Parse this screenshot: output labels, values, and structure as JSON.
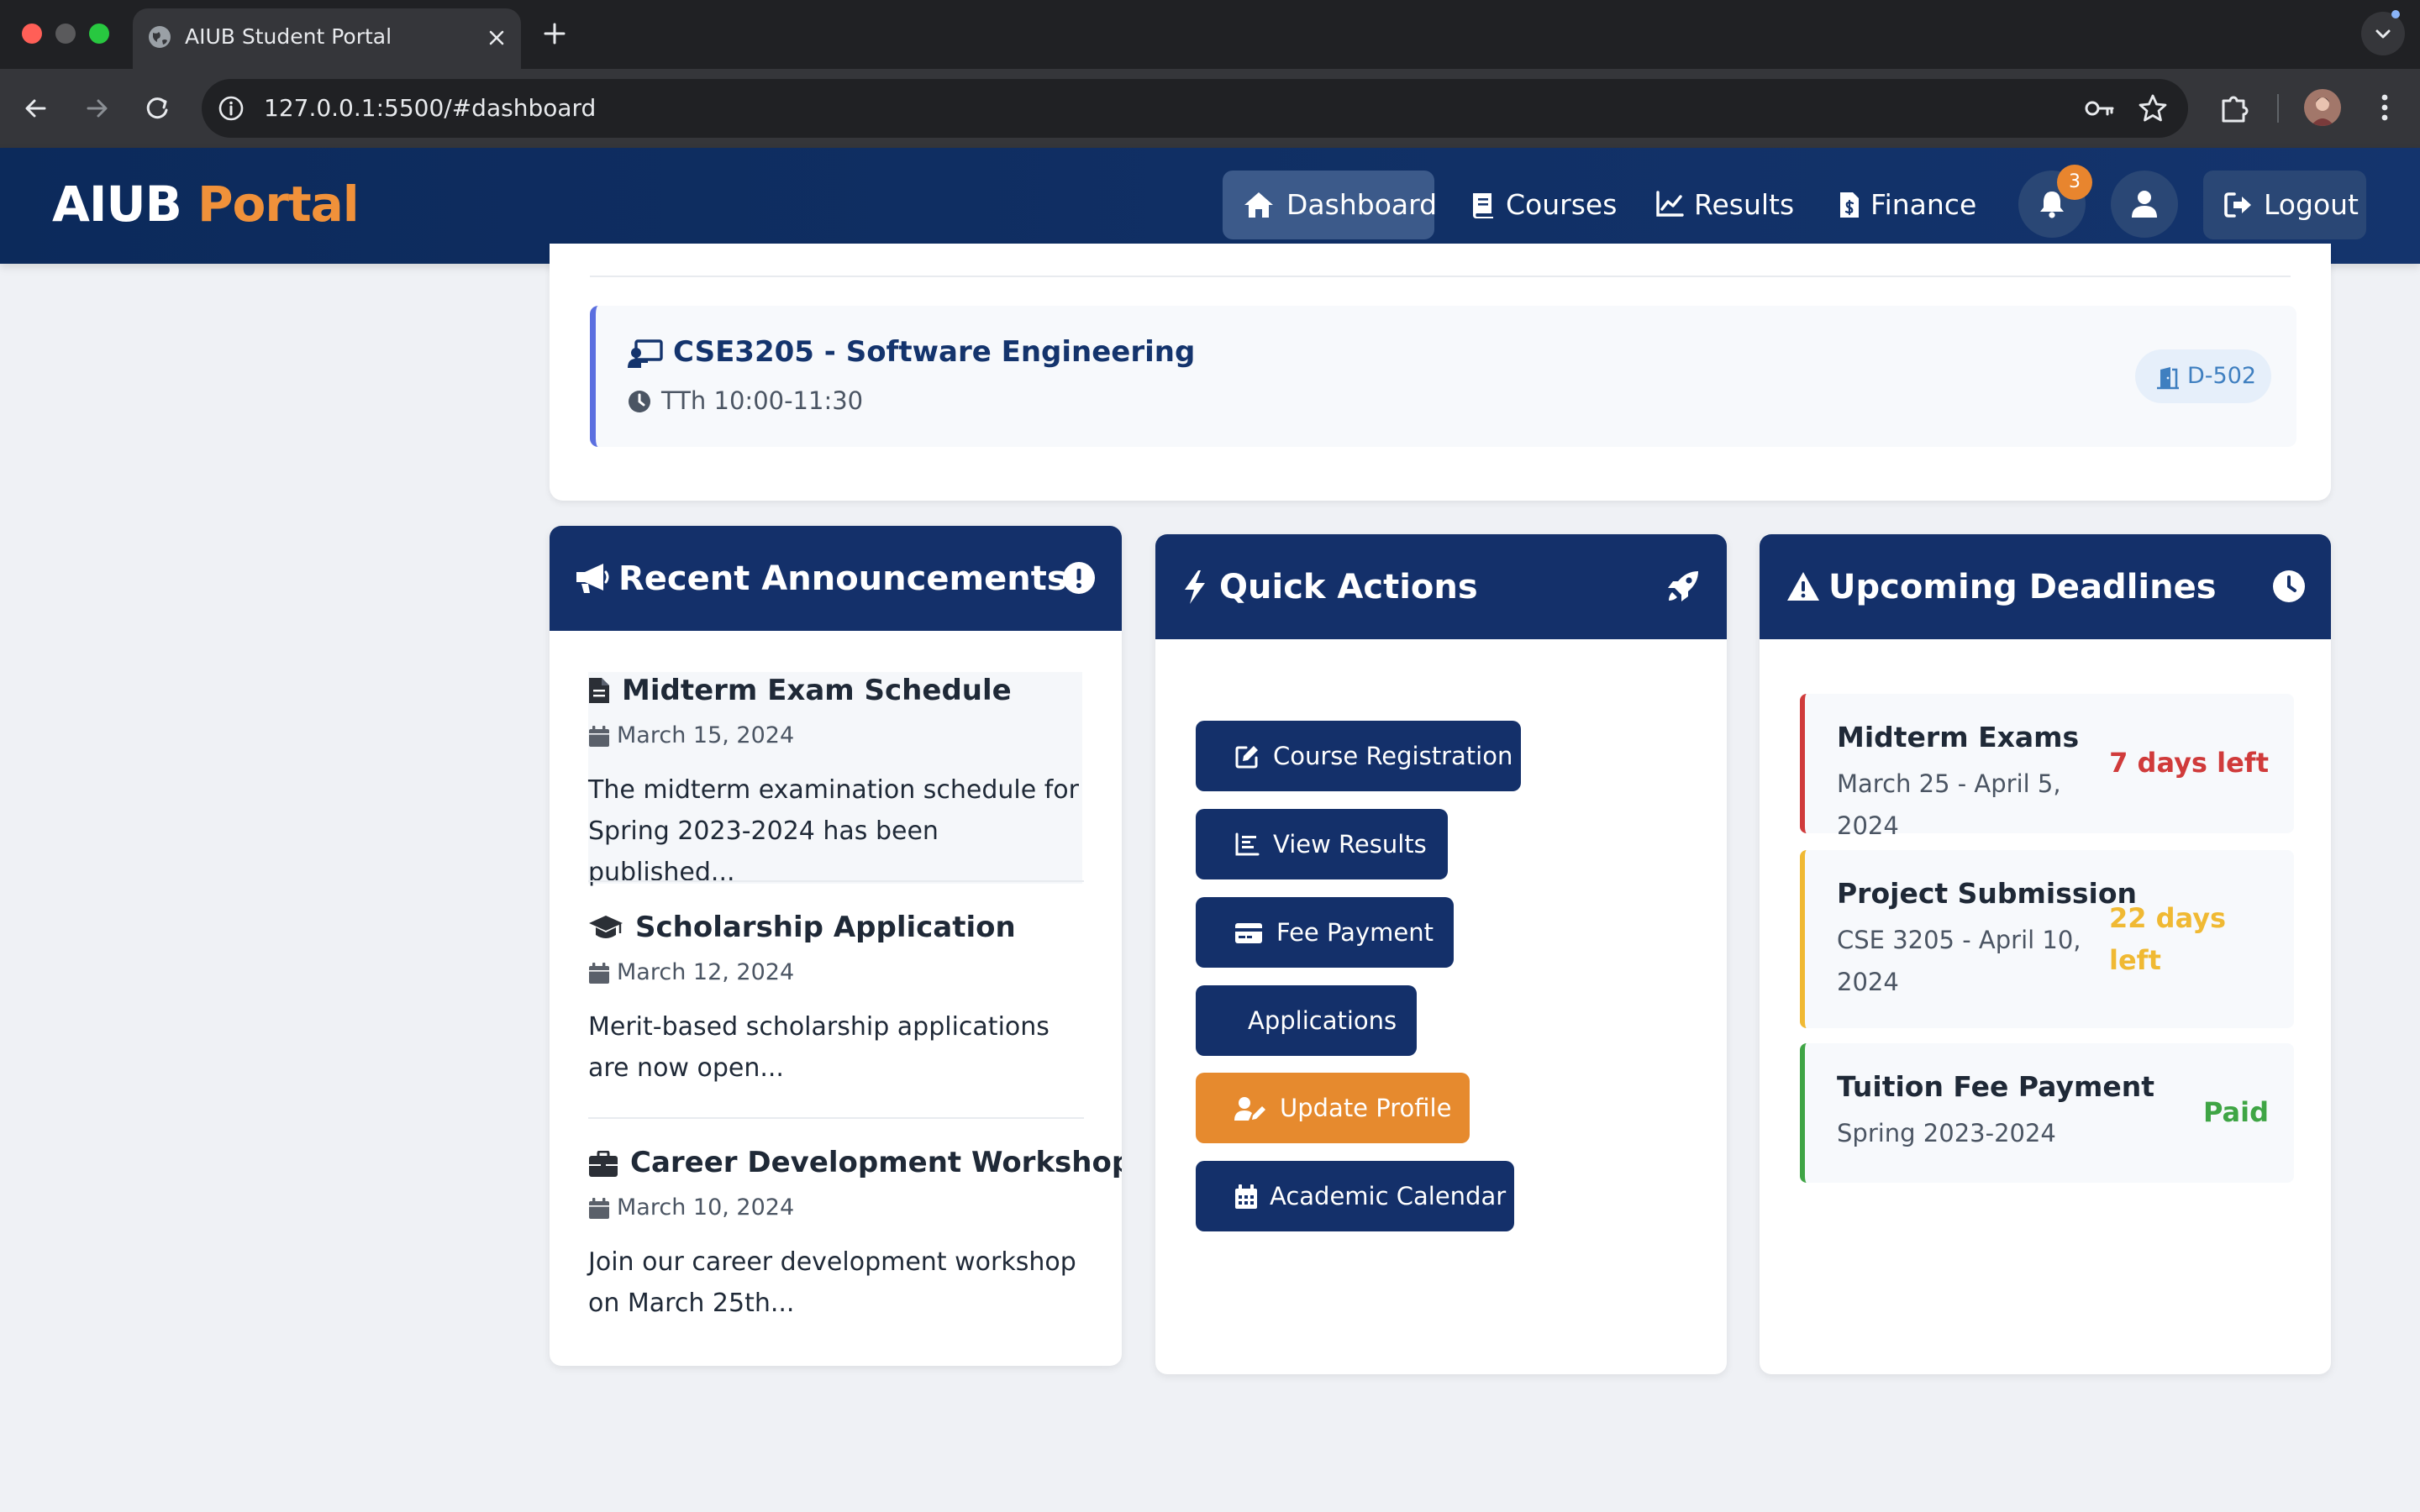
{
  "browser": {
    "tab_title": "AIUB Student Portal",
    "url": "127.0.0.1:5500/#dashboard"
  },
  "header": {
    "brand_part1": "AIUB",
    "brand_part2": "Portal",
    "nav": [
      {
        "label": "Dashboard",
        "icon": "home-icon",
        "active": true
      },
      {
        "label": "Courses",
        "icon": "book-icon",
        "active": false
      },
      {
        "label": "Results",
        "icon": "chart-line-icon",
        "active": false
      },
      {
        "label": "Finance",
        "icon": "invoice-icon",
        "active": false
      }
    ],
    "notification_count": "3",
    "logout_label": "Logout"
  },
  "schedule": {
    "title": "CSE3205 - Software Engineering",
    "time": "TTh 10:00-11:30",
    "room": "D-502"
  },
  "announcements": {
    "title": "Recent Announcements",
    "items": [
      {
        "icon": "file-icon",
        "title": "Midterm Exam Schedule",
        "date": "March 15, 2024",
        "body": "The midterm examination schedule for Spring 2023-2024 has been published..."
      },
      {
        "icon": "graduation-cap-icon",
        "title": "Scholarship Application",
        "date": "March 12, 2024",
        "body": "Merit-based scholarship applications are now open..."
      },
      {
        "icon": "briefcase-icon",
        "title": "Career Development Workshop",
        "date": "March 10, 2024",
        "body": "Join our career development workshop on March 25th..."
      }
    ]
  },
  "quick_actions": {
    "title": "Quick Actions",
    "buttons": [
      {
        "label": "Course Registration",
        "icon": "edit-icon"
      },
      {
        "label": "View Results",
        "icon": "chart-bar-icon"
      },
      {
        "label": "Fee Payment",
        "icon": "credit-card-icon"
      },
      {
        "label": "Applications",
        "icon": ""
      },
      {
        "label": "Update Profile",
        "icon": "user-edit-icon"
      },
      {
        "label": "Academic Calendar",
        "icon": "calendar-icon"
      }
    ]
  },
  "deadlines": {
    "title": "Upcoming Deadlines",
    "items": [
      {
        "title": "Midterm Exams",
        "subtitle": "March 25 - April 5, 2024",
        "status": "7 days left",
        "color": "#d03b3b"
      },
      {
        "title": "Project Submission",
        "subtitle": "CSE 3205 - April 10, 2024",
        "status": "22 days left",
        "color": "#f0b933"
      },
      {
        "title": "Tuition Fee Payment",
        "subtitle": "Spring 2023-2024",
        "status": "Paid",
        "color": "#3fa545"
      }
    ]
  },
  "colors": {
    "header_bg": "#14346d",
    "brand_accent": "#f0913a",
    "update_profile_bg": "#e68a2e"
  }
}
